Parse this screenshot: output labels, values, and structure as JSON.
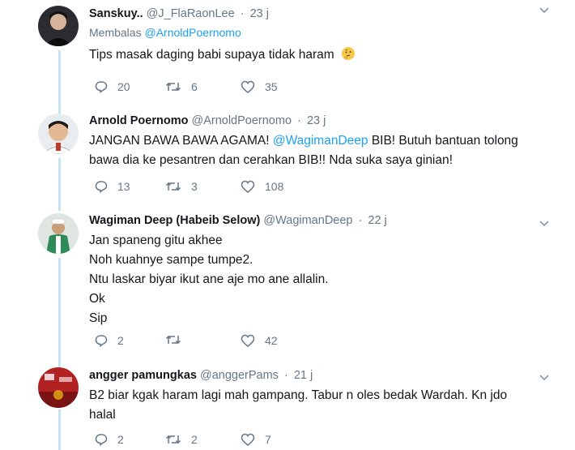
{
  "tweets": [
    {
      "name": "Sanskuy..",
      "handle": "@J_FlaRaonLee",
      "time": "23 j",
      "replying_prefix": "Membalas",
      "replying_to": "@ArnoldPoernomo",
      "lines": [
        "Tips masak daging babi supaya tidak haram"
      ],
      "emoji": "thinking-face",
      "replies": "20",
      "retweets": "6",
      "likes": "35"
    },
    {
      "name": "Arnold Poernomo",
      "handle": "@ArnoldPoernomo",
      "time": "23 j",
      "text_a": "JANGAN BAWA BAWA AGAMA!",
      "mention": "@WagimanDeep",
      "text_b": "BIB! Butuh bantuan tolong",
      "text_c": "bawa dia ke pesantren dan cerahkan BIB!! Nda suka saya ginian!",
      "replies": "13",
      "retweets": "3",
      "likes": "108"
    },
    {
      "name": "Wagiman Deep (Habeib Selow)",
      "handle": "@WagimanDeep",
      "time": "22 j",
      "lines": [
        "Jan spaneng gitu akhee",
        "Noh kuahnye sampe tumpe2.",
        "Ntu laskar biyar ikut ane aje mo ane allalin.",
        "Ok",
        "Sip"
      ],
      "replies": "2",
      "retweets": "",
      "likes": "42"
    },
    {
      "name": "angger pamungkas",
      "handle": "@anggerPams",
      "time": "21 j",
      "lines": [
        "B2 biar kgak haram lagi mah gampang. Tabur n oles bedak Wardah. Kn jdo",
        "halal"
      ],
      "replies": "2",
      "retweets": "2",
      "likes": "7"
    }
  ],
  "colors": {
    "link": "#1da1f2",
    "thread_line": "#c4e3f5",
    "muted": "#657786",
    "text": "#14171a"
  }
}
